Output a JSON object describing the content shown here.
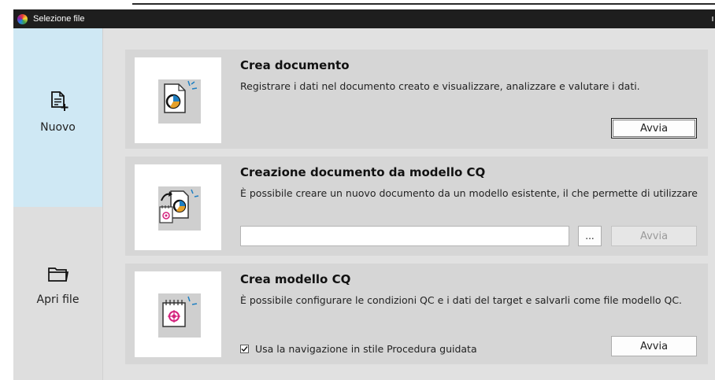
{
  "window": {
    "title": "Selezione file"
  },
  "sidebar": {
    "new": {
      "label": "Nuovo",
      "icon": "new-document-icon"
    },
    "open": {
      "label": "Apri file",
      "icon": "folder-icon"
    }
  },
  "panels": {
    "create_document": {
      "title": "Crea documento",
      "description": "Registrare i dati nel documento creato e visualizzare, analizzare e valutare i dati.",
      "button": "Avvia",
      "icon": "document-chart-icon"
    },
    "from_template": {
      "title": "Creazione documento da modello CQ",
      "description": "È possibile creare un nuovo documento da un modello esistente, il che permette di utilizzare la stessa configurazione.",
      "input_value": "",
      "browse_label": "...",
      "button": "Avvia",
      "icon": "template-to-document-icon"
    },
    "create_template": {
      "title": "Crea modello CQ",
      "description": "È possibile configurare le condizioni QC e i dati del target e salvarli come file modello QC.",
      "checkbox_label": "Usa la navigazione in stile Procedura guidata",
      "checkbox_checked": true,
      "button": "Avvia",
      "icon": "calendar-target-icon"
    }
  },
  "colors": {
    "accent_blue": "#1e7fc2",
    "accent_magenta": "#d4247e",
    "selected_sidebar": "#cfe8f4"
  }
}
